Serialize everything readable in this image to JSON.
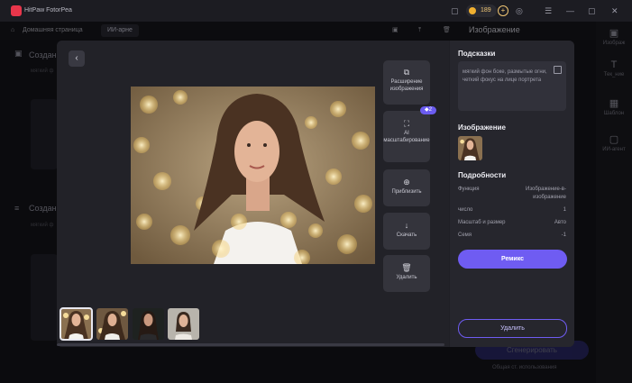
{
  "app": {
    "name": "HitPaw FotorPea",
    "credits": "189"
  },
  "nav": {
    "home": "Домашняя страница",
    "tab": "ИИ-арне"
  },
  "right_title": "Изображение",
  "right_sidebar": [
    {
      "label": "Изображ",
      "icon": "image-icon"
    },
    {
      "label": "Тек_ние",
      "icon": "text-icon"
    },
    {
      "label": "Шаблон",
      "icon": "template-icon"
    },
    {
      "label": "ИИ-агент",
      "icon": "agent-icon"
    }
  ],
  "background": {
    "section1": "Создан",
    "section1_sub": "мягкий ф",
    "section2": "Создан",
    "section2_sub": "мягкий ф",
    "generate": "Сгенерировать",
    "generate_sub": "Общая ст. использования"
  },
  "viewer": {
    "tools": [
      {
        "label": "Расширение изображения",
        "icon": "expand-icon"
      },
      {
        "label": "AI масштабирование",
        "icon": "upscale-icon",
        "badge": "2"
      },
      {
        "label": "Приблизить",
        "icon": "zoom-icon"
      },
      {
        "label": "Скачать",
        "icon": "download-icon"
      },
      {
        "label": "Удалить",
        "icon": "trash-icon"
      }
    ]
  },
  "info": {
    "prompt_heading": "Подсказки",
    "prompt_text": "мягкий фон боке, размытые огни, четкий фокус на лице портрета",
    "image_heading": "Изображение",
    "details_heading": "Подробности",
    "details": [
      {
        "label": "Функция",
        "value": "Изображение-в-изображение"
      },
      {
        "label": "число",
        "value": "1"
      },
      {
        "label": "Масштаб и размер",
        "value": "Авто"
      },
      {
        "label": "Семя",
        "value": "-1"
      }
    ],
    "remix": "Ремикс",
    "delete": "Удалить"
  },
  "colors": {
    "accent": "#6f5cf2",
    "bg": "#15151a",
    "panel": "#26262d"
  }
}
